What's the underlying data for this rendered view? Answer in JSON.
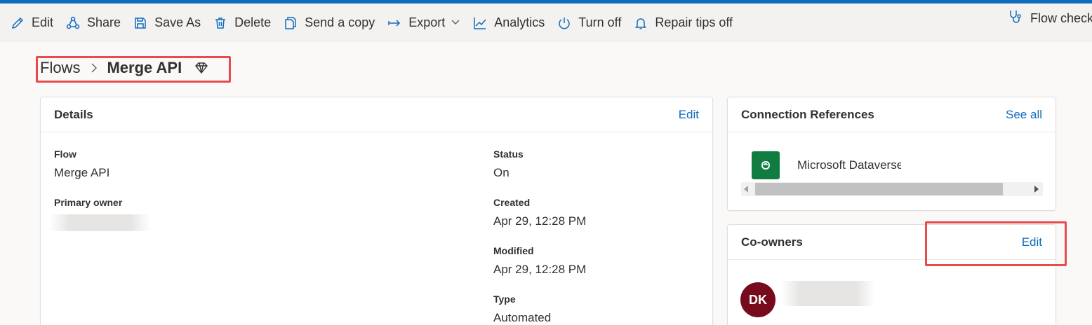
{
  "toolbar": {
    "items": [
      {
        "label": "Edit",
        "icon": "pencil-icon"
      },
      {
        "label": "Share",
        "icon": "share-icon"
      },
      {
        "label": "Save As",
        "icon": "save-as-icon"
      },
      {
        "label": "Delete",
        "icon": "trash-icon"
      },
      {
        "label": "Send a copy",
        "icon": "copy-icon"
      },
      {
        "label": "Export",
        "icon": "export-arrow-icon"
      },
      {
        "label": "Analytics",
        "icon": "analytics-chart-icon"
      },
      {
        "label": "Turn off",
        "icon": "power-icon"
      },
      {
        "label": "Repair tips off",
        "icon": "bell-icon"
      }
    ],
    "flow_checker": "Flow checker"
  },
  "breadcrumb": {
    "parent": "Flows",
    "current": "Merge API"
  },
  "details": {
    "title": "Details",
    "edit_label": "Edit",
    "flow_label": "Flow",
    "flow_value": "Merge API",
    "primary_owner_label": "Primary owner",
    "status_label": "Status",
    "status_value": "On",
    "created_label": "Created",
    "created_value": "Apr 29, 12:28 PM",
    "modified_label": "Modified",
    "modified_value": "Apr 29, 12:28 PM",
    "type_label": "Type",
    "type_value": "Automated"
  },
  "connection_references": {
    "title": "Connection References",
    "see_all_label": "See all",
    "item_name": "Microsoft Dataverse"
  },
  "co_owners": {
    "title": "Co-owners",
    "edit_label": "Edit",
    "avatar_initials": "DK"
  },
  "colors": {
    "accent": "#0f6cbd",
    "highlight_box": "#e74b4b",
    "dataverse": "#107c41",
    "avatar": "#750b1c"
  }
}
